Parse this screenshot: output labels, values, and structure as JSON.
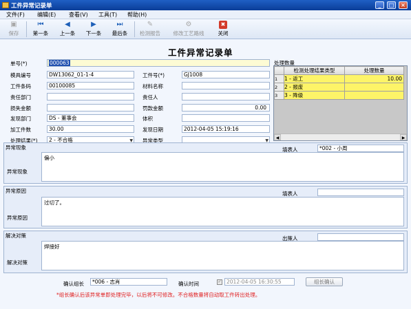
{
  "window": {
    "title": "工件异常记录单",
    "minimize": "_",
    "maximize": "□",
    "close": "×"
  },
  "menu": [
    "文件(F)",
    "编辑(E)",
    "查看(V)",
    "工具(T)",
    "帮助(H)"
  ],
  "toolbar": {
    "save": "保存",
    "first": "第一条",
    "prev": "上一条",
    "next": "下一条",
    "last": "最后条",
    "check_report": "检测报告",
    "modify_route": "修改工艺路线",
    "close": "关闭"
  },
  "icons": {
    "save": "save-icon",
    "first": "first-icon",
    "prev": "prev-icon",
    "next": "next-icon",
    "last": "last-icon",
    "report": "report-icon",
    "route": "route-icon",
    "close": "close-icon"
  },
  "form": {
    "title": "工件异常记录单",
    "order_no": {
      "label": "单号(*)",
      "value": "000063"
    },
    "mold_no": {
      "label": "模具编号",
      "value": "DW13062_01-1-4"
    },
    "process_no": {
      "label": "工件号(*)",
      "value": "GJ1008"
    },
    "workpiece_code": {
      "label": "工件条码",
      "value": "00100085"
    },
    "material_name": {
      "label": "材料名称",
      "value": ""
    },
    "resp_dept": {
      "label": "责任部门",
      "value": ""
    },
    "resp_person": {
      "label": "责任人",
      "value": ""
    },
    "loss_amount": {
      "label": "损失金额",
      "value": ""
    },
    "fine_amount": {
      "label": "罚款金额",
      "value": "0.00"
    },
    "found_dept": {
      "label": "发现部门",
      "value": "DS - 董事会"
    },
    "volume": {
      "label": "体积",
      "value": ""
    },
    "process_qty": {
      "label": "加工件数",
      "value": "30.00"
    },
    "found_date": {
      "label": "发现日期",
      "value": "2012-04-05 15:19:16"
    },
    "handle_result": {
      "label": "处理结果(*)",
      "value": "2 - 不合格"
    },
    "abnormal_type": {
      "label": "异常类型",
      "value": ""
    }
  },
  "handle_qty": {
    "title": "处理数量",
    "columns": [
      "检测处理结果类型",
      "处理数量"
    ],
    "rows": [
      {
        "n": "1",
        "type": "1 - 返工",
        "qty": "10.00"
      },
      {
        "n": "2",
        "type": "2 - 报废",
        "qty": ""
      },
      {
        "n": "3",
        "type": "3 - 降级",
        "qty": ""
      }
    ]
  },
  "sections": {
    "phenomenon": {
      "title": "异常现象",
      "side_label": "异常现象",
      "filler_label": "填表人",
      "filler_value": "*002 - 小周",
      "text": "偏小"
    },
    "cause": {
      "title": "异常原因",
      "side_label": "异常原因",
      "filler_label": "填表人",
      "filler_value": "",
      "text": "过切了。"
    },
    "solution": {
      "title": "解决对策",
      "side_label": "解决对策",
      "filler_label": "出策人",
      "filler_value": "",
      "text": "焊接好"
    }
  },
  "confirm": {
    "leader_label": "确认组长",
    "leader_value": "*006 - 志肖",
    "time_label": "确认时间",
    "time_value": "2012-04-05 16:30:55",
    "button": "组长确认"
  },
  "notice": "*组长确认后该异常单即处理完毕，以后将不可修改。不合格数量将自动取工件转出处理。"
}
